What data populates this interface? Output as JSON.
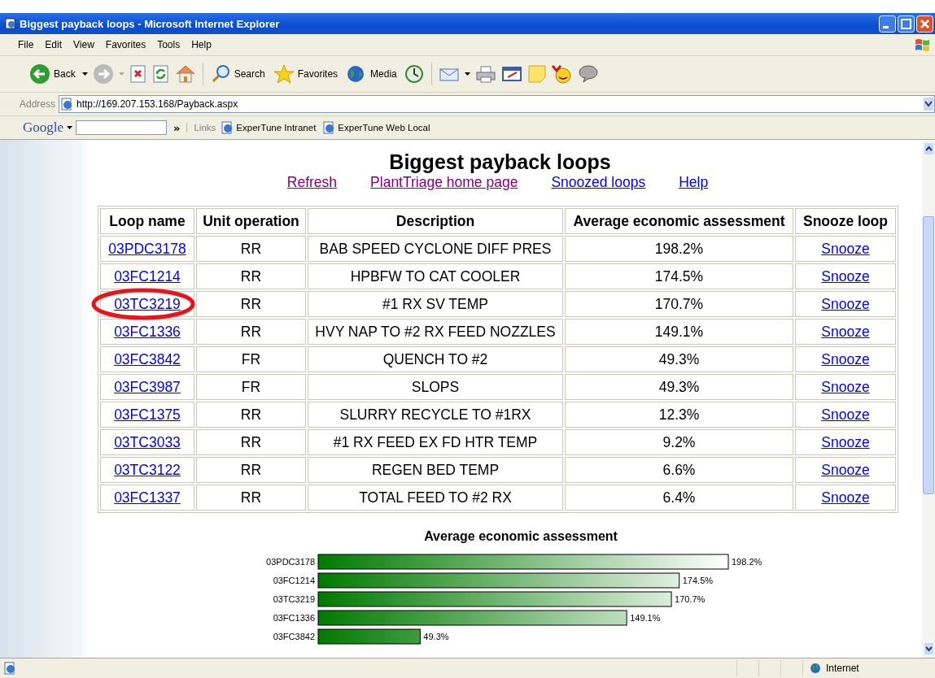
{
  "window": {
    "title": "Biggest payback loops - Microsoft Internet Explorer"
  },
  "menu": [
    "File",
    "Edit",
    "View",
    "Favorites",
    "Tools",
    "Help"
  ],
  "toolbar": {
    "back": "Back",
    "search": "Search",
    "favorites": "Favorites",
    "media": "Media"
  },
  "address": {
    "label": "Address",
    "url": "http://169.207.153.168/Payback.aspx"
  },
  "links_bar": {
    "google": "Google",
    "more": "»",
    "label": "Links",
    "links": [
      "ExperTune Intranet",
      "ExperTune Web Local"
    ]
  },
  "page": {
    "heading": "Biggest payback loops",
    "nav": [
      {
        "label": "Refresh",
        "visited": true
      },
      {
        "label": "PlantTriage home page",
        "visited": true
      },
      {
        "label": "Snoozed loops",
        "visited": false
      },
      {
        "label": "Help",
        "visited": false
      }
    ],
    "table": {
      "columns": [
        "Loop name",
        "Unit operation",
        "Description",
        "Average economic assessment",
        "Snooze loop"
      ],
      "rows": [
        {
          "loop": "03PDC3178",
          "unit": "RR",
          "description": "BAB SPEED CYCLONE DIFF PRES",
          "assessment": "198.2%",
          "action": "Snooze"
        },
        {
          "loop": "03FC1214",
          "unit": "RR",
          "description": "HPBFW TO CAT COOLER",
          "assessment": "174.5%",
          "action": "Snooze"
        },
        {
          "loop": "03TC3219",
          "unit": "RR",
          "description": "#1 RX SV TEMP",
          "assessment": "170.7%",
          "action": "Snooze"
        },
        {
          "loop": "03FC1336",
          "unit": "RR",
          "description": "HVY NAP TO #2 RX FEED NOZZLES",
          "assessment": "149.1%",
          "action": "Snooze"
        },
        {
          "loop": "03FC3842",
          "unit": "FR",
          "description": "QUENCH TO #2",
          "assessment": "49.3%",
          "action": "Snooze"
        },
        {
          "loop": "03FC3987",
          "unit": "FR",
          "description": "SLOPS",
          "assessment": "49.3%",
          "action": "Snooze"
        },
        {
          "loop": "03FC1375",
          "unit": "RR",
          "description": "SLURRY RECYCLE TO #1RX",
          "assessment": "12.3%",
          "action": "Snooze"
        },
        {
          "loop": "03TC3033",
          "unit": "RR",
          "description": "#1 RX FEED EX FD HTR TEMP",
          "assessment": "9.2%",
          "action": "Snooze"
        },
        {
          "loop": "03TC3122",
          "unit": "RR",
          "description": "REGEN BED TEMP",
          "assessment": "6.6%",
          "action": "Snooze"
        },
        {
          "loop": "03FC1337",
          "unit": "RR",
          "description": "TOTAL FEED TO #2 RX",
          "assessment": "6.4%",
          "action": "Snooze"
        }
      ]
    },
    "chart": {
      "chart_data": {
        "type": "bar",
        "orientation": "horizontal",
        "title": "Average economic assessment",
        "categories": [
          "03PDC3178",
          "03FC1214",
          "03TC3219",
          "03FC1336",
          "03FC3842"
        ],
        "values": [
          198.2,
          174.5,
          170.7,
          149.1,
          49.3
        ],
        "value_labels": [
          "198.2%",
          "174.5%",
          "170.7%",
          "149.1%",
          "49.3%"
        ]
      }
    }
  },
  "status_bar": {
    "zone": "Internet"
  }
}
